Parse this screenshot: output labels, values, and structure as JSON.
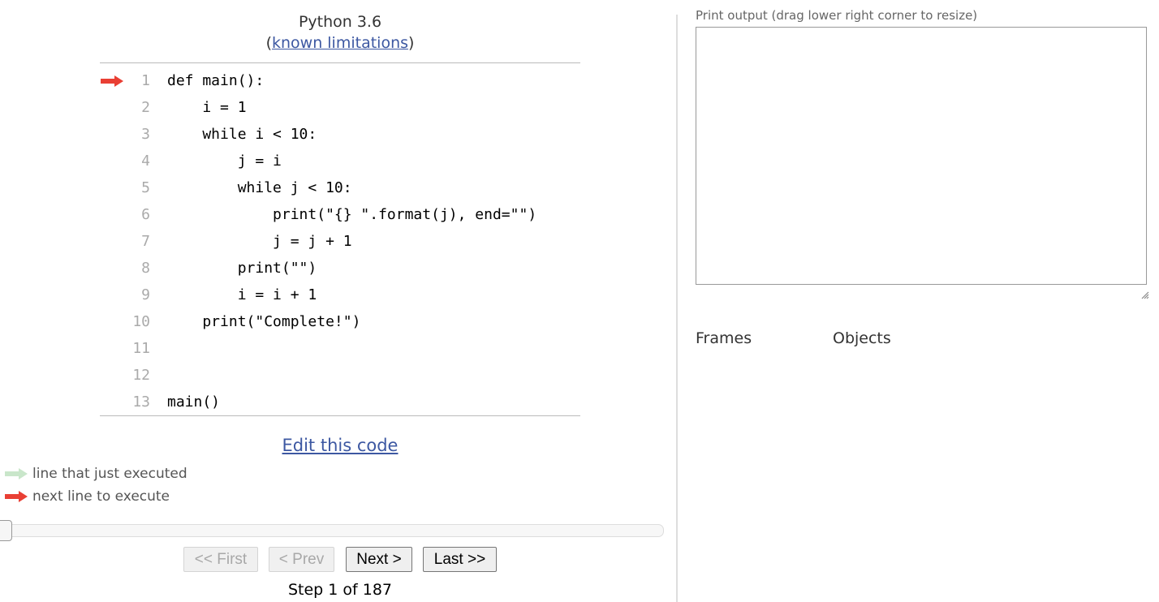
{
  "header": {
    "language": "Python 3.6",
    "limitations_open": "(",
    "limitations_link": "known limitations",
    "limitations_close": ")"
  },
  "code": {
    "current_line": 1,
    "lines": [
      {
        "no": "1",
        "text": "def main():"
      },
      {
        "no": "2",
        "text": "    i = 1"
      },
      {
        "no": "3",
        "text": "    while i < 10:"
      },
      {
        "no": "4",
        "text": "        j = i"
      },
      {
        "no": "5",
        "text": "        while j < 10:"
      },
      {
        "no": "6",
        "text": "            print(\"{} \".format(j), end=\"\")"
      },
      {
        "no": "7",
        "text": "            j = j + 1"
      },
      {
        "no": "8",
        "text": "        print(\"\")"
      },
      {
        "no": "9",
        "text": "        i = i + 1"
      },
      {
        "no": "10",
        "text": "    print(\"Complete!\")"
      },
      {
        "no": "11",
        "text": ""
      },
      {
        "no": "12",
        "text": ""
      },
      {
        "no": "13",
        "text": "main()"
      }
    ]
  },
  "edit_link": "Edit this code",
  "legend": {
    "executed": "line that just executed",
    "next": "next line to execute",
    "executed_color": "#C9E6CA",
    "next_color": "#E93F34"
  },
  "navigation": {
    "first": "<< First",
    "prev": "< Prev",
    "next": "Next >",
    "last": "Last >>",
    "first_disabled": true,
    "prev_disabled": true,
    "step_text": "Step 1 of 187",
    "current_step": 1,
    "total_steps": 187
  },
  "output": {
    "label": "Print output (drag lower right corner to resize)",
    "value": ""
  },
  "visualizer": {
    "frames_label": "Frames",
    "objects_label": "Objects"
  },
  "colors": {
    "link": "#3D58A2",
    "arrow_next": "#E93F34",
    "arrow_executed": "#C9E6CA"
  }
}
